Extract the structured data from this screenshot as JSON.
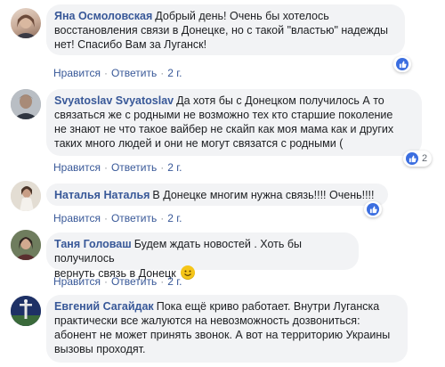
{
  "comments": [
    {
      "author": "Яна Осмоловская",
      "lines": [
        "Добрый день! Очень бы хотелось",
        "восстановления связи в Донецке, но с такой \"властью\" надежды",
        "нет! Спасибо Вам за Луганск!"
      ],
      "like_label": "Нравится",
      "reply_label": "Ответить",
      "time": "2 г.",
      "reaction_count": ""
    },
    {
      "author": "Svyatoslav Svyatoslav",
      "lines": [
        "Да хотя бы с Донецком получилось А то",
        "связаться же с родными не возможно тех кто старшие поколение",
        "не знают не что такое вайбер не скайп как моя мама как и других",
        "таких много людей и они не могут связатся с родными ("
      ],
      "like_label": "Нравится",
      "reply_label": "Ответить",
      "time": "2 г.",
      "reaction_count": "2"
    },
    {
      "author": "Наталья Наталья",
      "lines": [
        "В Донецке многим нужна связь!!!! Очень!!!!"
      ],
      "like_label": "Нравится",
      "reply_label": "Ответить",
      "time": "2 г.",
      "reaction_count": ""
    },
    {
      "author": "Таня Головаш",
      "lines": [
        "Будем ждать новостей . Хоть бы получилось",
        "вернуть связь в Донецк"
      ],
      "like_label": "Нравится",
      "reply_label": "Ответить",
      "time": "2 г.",
      "reaction_count": ""
    },
    {
      "author": "Евгений Сагайдак",
      "lines": [
        "Пока ещё криво работает. Внутри Луганска",
        "практически все жалуются на невозможность дозвониться:",
        "абонент не может принять звонок. А вот на территорию Украины",
        "вызовы проходят."
      ],
      "like_label": "",
      "reply_label": "",
      "time": "",
      "reaction_count": ""
    }
  ],
  "colors": {
    "author": "#385898",
    "bubble": "#f2f3f5",
    "like_badge": "#3b6ee0"
  }
}
